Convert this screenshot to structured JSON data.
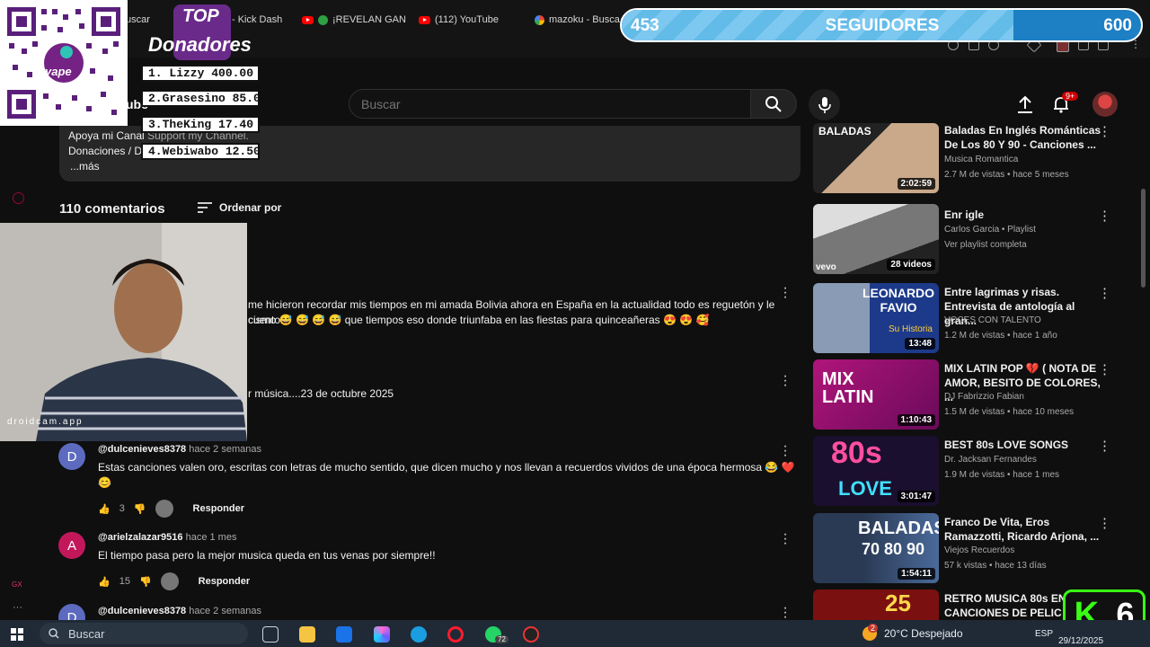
{
  "browser": {
    "tabs": [
      {
        "label": "uscar",
        "icon": "none"
      },
      {
        "label": "- Kick Dash",
        "icon": "none"
      },
      {
        "label": "¡REVELAN GAN",
        "icon": "youtube-icon"
      },
      {
        "label": "(112) YouTube",
        "icon": "youtube-icon"
      },
      {
        "label": "mazoku - Busca",
        "icon": "google-icon"
      }
    ]
  },
  "youtube": {
    "logo_fragment": "ube",
    "search": {
      "placeholder": "Buscar"
    },
    "notifications_badge": "9+",
    "description": {
      "line1_visible": "Apoya mi Canal",
      "line1_tail": "Support my Channel.",
      "line2_visible": "Donaciones / D",
      "more": "...más"
    },
    "comments": {
      "count_label": "110 comentarios",
      "sort_label": "Ordenar por",
      "items": [
        {
          "text_line1": "me hicieron recordar mis tiempos en mi amada Bolivia ahora en España en la actualidad todo es reguetón y le cuento a",
          "text_line2": "cismo 😅 😅 😅 😅 que tiempos eso donde triunfaba en las fiestas para quinceañeras 😍 😍 🥰"
        },
        {
          "text_line1": "r música....23 de octubre 2025"
        },
        {
          "author": "@dulcenieves8378",
          "time": "hace 2 semanas",
          "avatar_letter": "D",
          "text_line1": "Estas canciones valen oro, escritas con letras de mucho sentido, que dicen mucho y nos llevan a recuerdos vividos de una época hermosa 😂 ❤️ 😂",
          "text_line2": "😊",
          "likes": "3",
          "reply": "Responder"
        },
        {
          "author": "@arielzalazar9516",
          "time": "hace 1 mes",
          "avatar_letter": "A",
          "text_line1": "El tiempo pasa pero la mejor musica queda en tus venas por siempre!!",
          "likes": "15",
          "reply": "Responder"
        },
        {
          "author": "@dulcenieves8378",
          "time": "hace 2 semanas",
          "avatar_letter": "D"
        }
      ]
    },
    "sidebar": [
      {
        "title": "Baladas En Inglés Románticas De Los 80 Y 90 - Canciones ...",
        "channel": "Musica Romantica",
        "meta": "2.7 M de vistas • hace 5 meses",
        "duration": "2:02:59",
        "thumb_text": "BALADAS"
      },
      {
        "title": "Enr igle",
        "channel": "Carlos Garcia • Playlist",
        "meta": "Ver playlist completa",
        "duration": "28 videos",
        "thumb_text": "vevo"
      },
      {
        "title": "Entre lagrimas y risas. Entrevista de antología al gran...",
        "channel": "VOCES CON TALENTO",
        "meta": "1.2 M de vistas • hace 1 año",
        "duration": "13:48",
        "thumb_text": "LEONARDO FAVIO",
        "thumb_sub": "Su Historia"
      },
      {
        "title": "MIX LATIN POP 💔 ( NOTA DE AMOR, BESITO DE COLORES, ...",
        "channel": "DJ Fabrizzio Fabian",
        "meta": "1.5 M de vistas • hace 10 meses",
        "duration": "1:10:43",
        "thumb_text": "MIX LATIN"
      },
      {
        "title": "BEST 80s LOVE SONGS",
        "channel": "Dr. Jacksan Fernandes",
        "meta": "1.9 M de vistas • hace 1 mes",
        "duration": "3:01:47",
        "thumb_text": "80s",
        "thumb_sub": "LOVE"
      },
      {
        "title": "Franco De Vita, Eros Ramazzotti, Ricardo Arjona, ...",
        "channel": "Viejos Recuerdos",
        "meta": "57 k vistas • hace 13 días",
        "duration": "1:54:11",
        "thumb_text": "BALADAS",
        "thumb_sub": "70 80 90"
      },
      {
        "title": "RETRO MUSICA 80s EN | CANCIONES DE PELIC",
        "channel": "",
        "meta": "",
        "duration": "",
        "thumb_text": "25"
      }
    ]
  },
  "overlays": {
    "qr_caption": "yape",
    "donors_title_top": "TOP",
    "donors_title_main": "Donadores",
    "donors": [
      "1. Lizzy 400.00",
      "2.Grasesino 85.00",
      "3.TheKing 17.40",
      "4.Webiwabo 12.50"
    ],
    "followers": {
      "current": "453",
      "label": "SEGUIDORES",
      "goal": "600",
      "progress_fraction": 0.755
    },
    "webcam_watermark": "droidcam.app",
    "badge": {
      "letter": "K",
      "number": "6"
    }
  },
  "taskbar": {
    "search_label": "Buscar",
    "whatsapp_badge": "72",
    "weather": "20°C  Despejado",
    "weather_badge": "2",
    "lang": "ESP",
    "date": "29/12/2025"
  },
  "colors": {
    "youtube_bg": "#0f0f0f",
    "accent_red": "#ff0000",
    "followers_blue": "#1d7fc4",
    "badge_green": "#39ff14"
  }
}
